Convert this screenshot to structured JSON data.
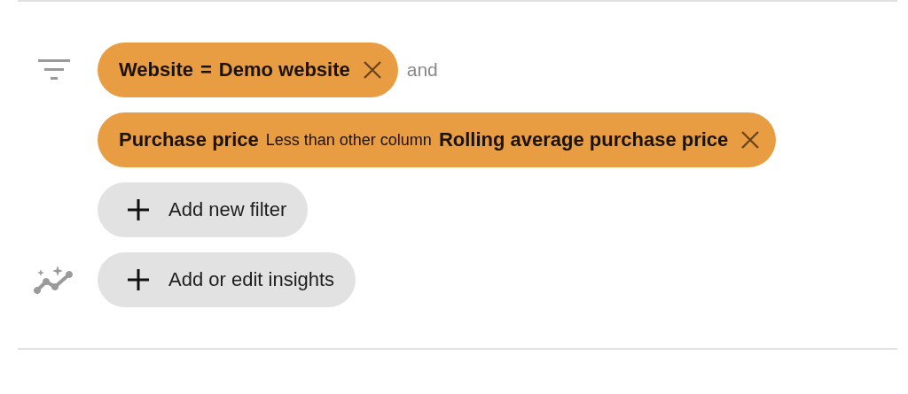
{
  "filters": [
    {
      "parts": [
        {
          "kind": "strong",
          "text": "Website"
        },
        {
          "kind": "strong",
          "text": "="
        },
        {
          "kind": "strong",
          "text": "Demo website"
        }
      ],
      "connector": "and"
    },
    {
      "parts": [
        {
          "kind": "strong",
          "text": "Purchase price"
        },
        {
          "kind": "plain",
          "text": "Less than other column"
        },
        {
          "kind": "strong",
          "text": "Rolling average purchase price"
        }
      ]
    }
  ],
  "add_filter_button": "Add new filter",
  "insights_button": "Add or edit insights"
}
